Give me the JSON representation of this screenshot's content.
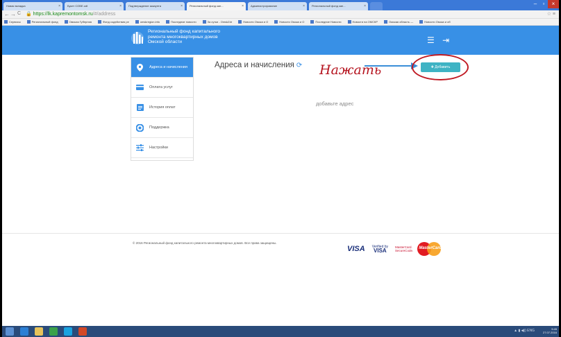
{
  "browser": {
    "tabs": [
      "Новая вкладка",
      "Букет СОВЕ.odt",
      "Подтверждение аккаунта",
      "Региональный фонд кап...",
      "Администрирование",
      "Региональный фонд кап..."
    ],
    "url_host": "https://lk.kapremontomsk.ru",
    "url_path": "/#/address",
    "bookmarks": [
      "Сервисы",
      "Региональный фонд",
      "Омская Губерния",
      "Фонд содействия ре",
      "omskregion.info",
      "Последние новости",
      "За сутки - OmskZdr",
      "Новости Омска и О",
      "Новости Омска и О",
      "Последние Новости",
      "Новости на ОМСКР",
      "Омская область —",
      "Новости Омска и об"
    ]
  },
  "header": {
    "brand_line1": "Региональный фонд капитального",
    "brand_line2": "ремонта многоквартирных домов",
    "brand_line3": "Омской области",
    "menu_icon": "hamburger-icon",
    "logout_icon": "logout-icon"
  },
  "sidebar": {
    "items": [
      {
        "label": "Адреса и начисления",
        "icon": "location-pin-icon"
      },
      {
        "label": "Оплата услуг",
        "icon": "card-icon"
      },
      {
        "label": "История оплат",
        "icon": "receipt-icon"
      },
      {
        "label": "Поддержка",
        "icon": "support-icon"
      },
      {
        "label": "Настройки",
        "icon": "sliders-icon"
      }
    ]
  },
  "main": {
    "title": "Адреса и начисления",
    "hint": "Нажать",
    "add_button": "Добавить",
    "empty_text": "добавьте адрес"
  },
  "footer": {
    "copyright": "© 2016 Региональный фонд капитального ремонта многоквартирных домов. Все права защищены.",
    "visa": "VISA",
    "vbv_top": "Verified by",
    "vbv_bottom": "VISA",
    "mc_sc_top": "MasterCard.",
    "mc_sc_bottom": "SecureCode.",
    "mc": "MasterCard"
  },
  "taskbar": {
    "lang": "ENG",
    "time": "9:45",
    "date": "27.07.2016"
  },
  "colors": {
    "brand_blue": "#3890e6",
    "add_button": "#3fb3c4",
    "annotation_red": "#b5141f"
  }
}
